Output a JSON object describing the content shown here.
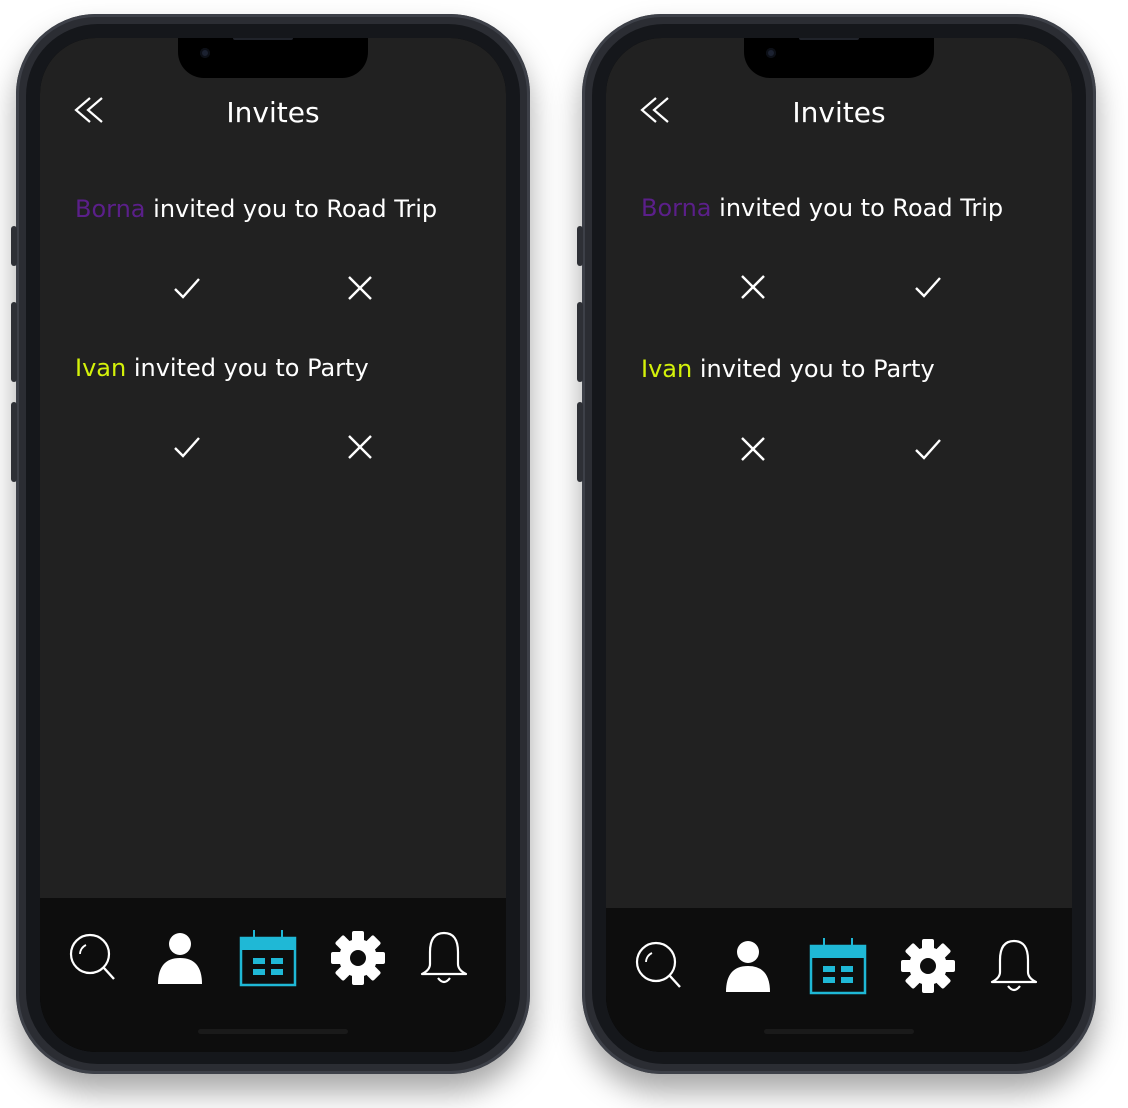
{
  "screens": [
    {
      "title": "Invites",
      "invites": [
        {
          "name": "Borna",
          "text": " invited you to Road Trip",
          "name_color": "#5b1f8a",
          "actions": [
            "accept",
            "decline"
          ]
        },
        {
          "name": "Ivan",
          "text": " invited you to Party",
          "name_color": "#d4f20a",
          "actions": [
            "accept",
            "decline"
          ]
        }
      ]
    },
    {
      "title": "Invites",
      "invites": [
        {
          "name": "Borna",
          "text": " invited you to Road Trip",
          "name_color": "#5b1f8a",
          "actions": [
            "decline",
            "accept"
          ]
        },
        {
          "name": "Ivan",
          "text": " invited you to Party",
          "name_color": "#d4f20a",
          "actions": [
            "decline",
            "accept"
          ]
        }
      ]
    }
  ],
  "nav": {
    "back_icon": "double-chevron-left-icon",
    "tabs": [
      "search-icon",
      "profile-icon",
      "calendar-icon",
      "settings-icon",
      "bell-icon"
    ],
    "active_tab": "calendar-icon",
    "active_color": "#1fb8d6"
  },
  "colors": {
    "background": "#212121",
    "tabbar": "#0d0d0d",
    "text": "#ffffff"
  }
}
